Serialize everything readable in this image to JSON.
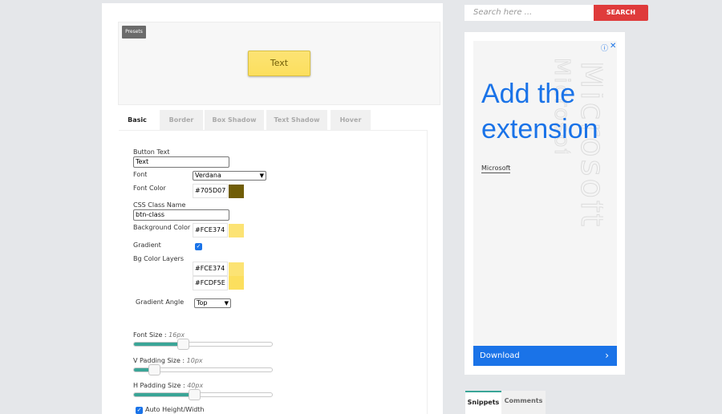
{
  "editor": {
    "presets_label": "Presets",
    "preview_text": "Text",
    "tabs": [
      {
        "label": "Basic"
      },
      {
        "label": "Border"
      },
      {
        "label": "Box Shadow"
      },
      {
        "label": "Text Shadow"
      },
      {
        "label": "Hover"
      }
    ],
    "fields": {
      "button_text_label": "Button Text",
      "button_text_value": "Text",
      "font_label": "Font",
      "font_value": "Verdana",
      "font_color_label": "Font Color",
      "font_color_value": "#705D07",
      "css_class_label": "CSS Class Name",
      "css_class_value": "btn-class",
      "bg_color_label": "Background Color",
      "bg_color_value": "#FCE374",
      "gradient_label": "Gradient",
      "gradient_checked": true,
      "bg_layers_label": "Bg Color Layers",
      "bg_layer_1": "#FCE374",
      "bg_layer_2": "#FCDF5E",
      "gradient_angle_label": "Gradient Angle",
      "gradient_angle_value": "Top"
    },
    "sliders": {
      "font_size_label": "Font Size :",
      "font_size_value": "16px",
      "font_size_fraction": 0.36,
      "v_padding_label": "V Padding Size :",
      "v_padding_value": "10px",
      "v_padding_fraction": 0.15,
      "h_padding_label": "H Padding Size :",
      "h_padding_value": "40px",
      "h_padding_fraction": 0.44
    },
    "auto_hw_label": "Auto Height/Width",
    "auto_hw_checked": true
  },
  "search": {
    "placeholder": "Search here ...",
    "button_label": "SEARCH"
  },
  "ad": {
    "headline": "Add the extension",
    "brand": "Microsoft",
    "watermark": "Microsoft",
    "cta": "Download",
    "info_icon": "info-icon",
    "close_icon": "close-icon"
  },
  "sidebar_tabs": [
    {
      "label": "Snippets"
    },
    {
      "label": "Comments"
    }
  ],
  "colors": {
    "accent_teal": "#3aa597",
    "search_red": "#df3b3b",
    "ad_blue": "#1a73e8",
    "font_color": "#705D07",
    "bg_color": "#FCE374",
    "bg_layer_2": "#FCDF5E"
  }
}
